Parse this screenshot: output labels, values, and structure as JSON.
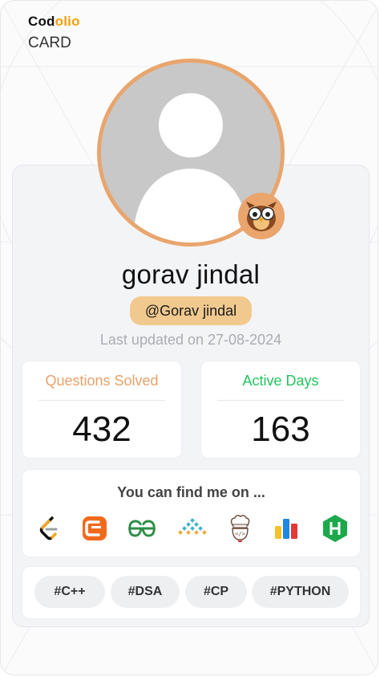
{
  "brand": {
    "logo_part1": "Cod",
    "logo_part2": "olio",
    "subtitle": "CARD"
  },
  "profile": {
    "name": "gorav jindal",
    "handle": "@Gorav jindal",
    "last_updated": "Last updated on 27-08-2024"
  },
  "stats": {
    "questions": {
      "label": "Questions Solved",
      "value": "432",
      "color": "#e7a26a"
    },
    "active": {
      "label": "Active Days",
      "value": "163",
      "color": "#22c55e"
    }
  },
  "find": {
    "title": "You can find me on ...",
    "platforms": [
      "leetcode-icon",
      "codestudio-icon",
      "geeksforgeeks-icon",
      "interviewbit-icon",
      "codechef-icon",
      "codeforces-icon",
      "hackerrank-icon"
    ]
  },
  "tags": [
    "#C++",
    "#DSA",
    "#CP",
    "#PYTHON"
  ],
  "colors": {
    "accent": "#e9a56c",
    "handle_bg": "#f1c98f",
    "brand_orange": "#f59e0b"
  }
}
